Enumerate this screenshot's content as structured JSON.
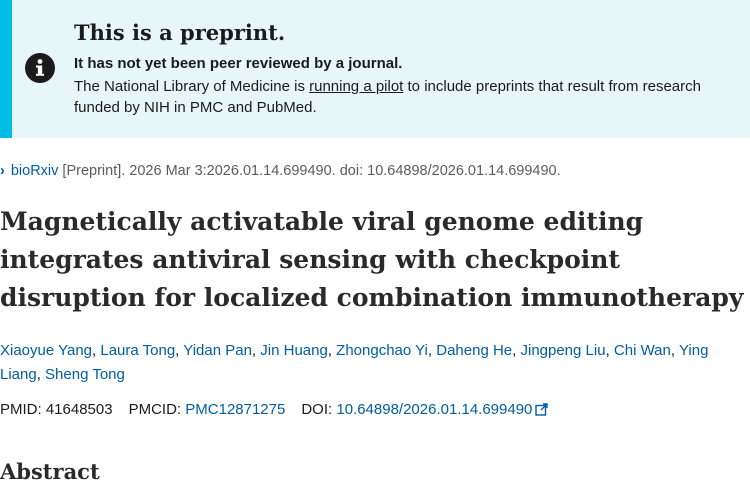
{
  "banner": {
    "heading": "This is a preprint.",
    "subheading": "It has not yet been peer reviewed by a journal.",
    "text_before": "The National Library of Medicine is ",
    "link": "running a pilot",
    "text_after": " to include preprints that result from research funded by NIH in PMC and PubMed.",
    "icon": "info-icon"
  },
  "source": {
    "icon": "chevron-right-icon",
    "journal": "bioRxiv",
    "details": " [Preprint]. 2026 Mar 3:2026.01.14.699490. doi: 10.64898/2026.01.14.699490."
  },
  "title": "Magnetically activatable viral genome editing integrates antiviral sensing with checkpoint disruption for localized combination immunotherapy",
  "authors": [
    "Xiaoyue Yang",
    "Laura Tong",
    "Yidan Pan",
    "Jin Huang",
    "Zhongchao Yi",
    "Daheng He",
    "Jingpeng Liu",
    "Chi Wan",
    "Ying Liang",
    "Sheng Tong"
  ],
  "author_separator": ", ",
  "ids": {
    "pmid_label": "PMID: ",
    "pmid": "41648503",
    "pmcid_label": "PMCID: ",
    "pmcid": "PMC12871275",
    "doi_label": "DOI: ",
    "doi": "10.64898/2026.01.14.699490",
    "doi_icon": "external-link-icon"
  },
  "abstract_heading": "Abstract",
  "colors": {
    "banner_bg": "#e7f6f8",
    "banner_accent": "#00bde3",
    "link": "#005ea2"
  }
}
